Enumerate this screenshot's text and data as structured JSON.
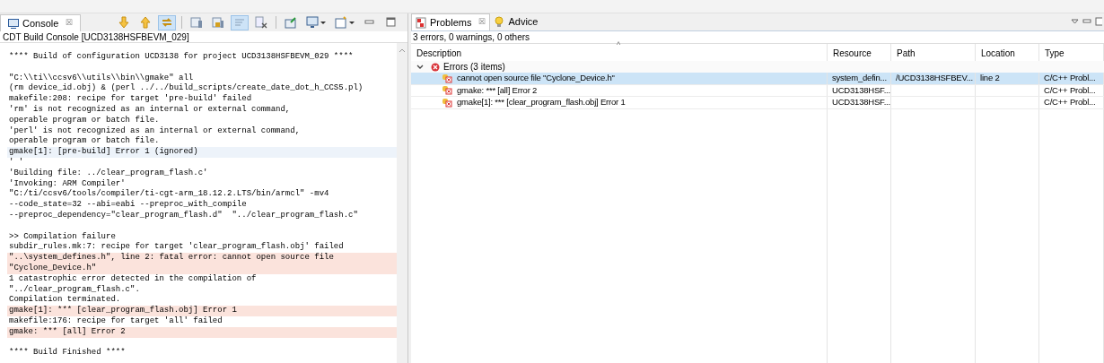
{
  "console": {
    "tab": {
      "label": "Console",
      "selected": true,
      "close": "☒"
    },
    "toolbar": [
      {
        "kind": "down",
        "selected": false
      },
      {
        "kind": "up",
        "selected": false
      },
      {
        "kind": "link",
        "selected": true
      },
      {
        "kind": "sep"
      },
      {
        "kind": "doc",
        "selected": false
      },
      {
        "kind": "lock",
        "selected": false
      },
      {
        "kind": "wrap",
        "selected": true
      },
      {
        "kind": "clear",
        "selected": false
      },
      {
        "kind": "sep"
      },
      {
        "kind": "pin",
        "selected": false
      },
      {
        "kind": "monitor",
        "selected": false,
        "dropdown": true
      },
      {
        "kind": "new",
        "selected": false,
        "dropdown": true
      },
      {
        "kind": "minimize"
      },
      {
        "kind": "maximize"
      }
    ],
    "subtitle": "CDT Build Console [UCD3138HSFBEVM_029]",
    "lines": [
      {
        "kind": "normal",
        "text": "**** Build of configuration UCD3138 for project UCD3138HSFBEVM_029 ****"
      },
      {
        "kind": "blank"
      },
      {
        "kind": "normal",
        "text": "\"C:\\\\ti\\\\ccsv6\\\\utils\\\\bin\\\\gmake\" all"
      },
      {
        "kind": "normal",
        "text": "(rm device_id.obj) & (perl ../../build_scripts/create_date_dot_h_CCS5.pl)"
      },
      {
        "kind": "normal",
        "text": "makefile:208: recipe for target 'pre-build' failed"
      },
      {
        "kind": "normal",
        "text": "'rm' is not recognized as an internal or external command,"
      },
      {
        "kind": "normal",
        "text": "operable program or batch file."
      },
      {
        "kind": "normal",
        "text": "'perl' is not recognized as an internal or external command,"
      },
      {
        "kind": "normal",
        "text": "operable program or batch file."
      },
      {
        "kind": "info",
        "text": "gmake[1]: [pre-build] Error 1 (ignored)"
      },
      {
        "kind": "normal",
        "text": "' '"
      },
      {
        "kind": "normal",
        "text": "'Building file: ../clear_program_flash.c'"
      },
      {
        "kind": "normal",
        "text": "'Invoking: ARM Compiler'"
      },
      {
        "kind": "normal",
        "text": "\"C:/ti/ccsv6/tools/compiler/ti-cgt-arm_18.12.2.LTS/bin/armcl\" -mv4"
      },
      {
        "kind": "normal",
        "text": "--code_state=32 --abi=eabi --preproc_with_compile"
      },
      {
        "kind": "normal",
        "text": "--preproc_dependency=\"clear_program_flash.d\"  \"../clear_program_flash.c\""
      },
      {
        "kind": "blank"
      },
      {
        "kind": "normal",
        "text": ">> Compilation failure"
      },
      {
        "kind": "normal",
        "text": "subdir_rules.mk:7: recipe for target 'clear_program_flash.obj' failed"
      },
      {
        "kind": "error",
        "text": "\"..\\system_defines.h\", line 2: fatal error: cannot open source file"
      },
      {
        "kind": "error",
        "text": "\"Cyclone_Device.h\""
      },
      {
        "kind": "normal",
        "text": "1 catastrophic error detected in the compilation of"
      },
      {
        "kind": "normal",
        "text": "\"../clear_program_flash.c\"."
      },
      {
        "kind": "normal",
        "text": "Compilation terminated."
      },
      {
        "kind": "error",
        "text": "gmake[1]: *** [clear_program_flash.obj] Error 1"
      },
      {
        "kind": "normal",
        "text": "makefile:176: recipe for target 'all' failed"
      },
      {
        "kind": "error",
        "text": "gmake: *** [all] Error 2"
      },
      {
        "kind": "blank"
      },
      {
        "kind": "normal",
        "text": "**** Build Finished ****"
      }
    ]
  },
  "problems": {
    "tabs": [
      {
        "label": "Problems",
        "selected": true,
        "close": "☒",
        "kind": "problems"
      },
      {
        "label": "Advice",
        "selected": false,
        "kind": "advice"
      }
    ],
    "summary": "3 errors, 0 warnings, 0 others",
    "sort_indicator": "^",
    "columns": [
      "Description",
      "Resource",
      "Path",
      "Location",
      "Type"
    ],
    "group": {
      "label": "Errors (3 items)",
      "expanded": true
    },
    "rows": [
      {
        "selected": true,
        "cells": [
          "cannot open source file \"Cyclone_Device.h\"",
          "system_defin...",
          "/UCD3138HSFBEV...",
          "line 2",
          "C/C++ Probl..."
        ]
      },
      {
        "selected": false,
        "cells": [
          "gmake: *** [all] Error 2",
          "UCD3138HSF...",
          "",
          "",
          "C/C++ Probl..."
        ]
      },
      {
        "selected": false,
        "cells": [
          "gmake[1]: *** [clear_program_flash.obj] Error 1",
          "UCD3138HSF...",
          "",
          "",
          "C/C++ Probl..."
        ]
      }
    ]
  }
}
